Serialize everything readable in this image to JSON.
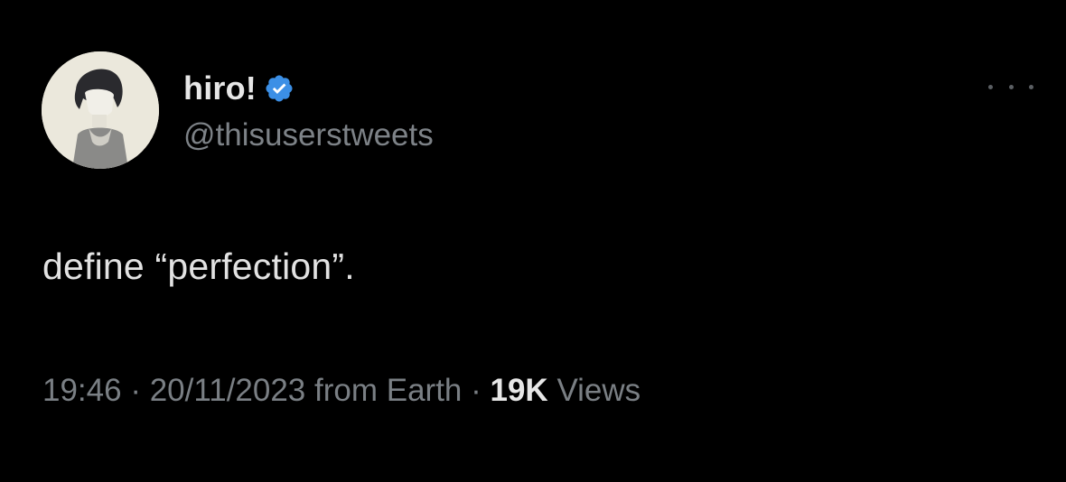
{
  "tweet": {
    "author": {
      "display_name": "hiro!",
      "handle": "@thisuserstweets",
      "verified_icon": "verified-badge-icon",
      "verified_color": "#3b8fe6"
    },
    "text": "define “perfection”.",
    "meta": {
      "time": "19:46",
      "separator1": " · ",
      "date": "20/11/2023",
      "source": " from Earth",
      "separator2": " · ",
      "views_count": "19K",
      "views_label": " Views"
    },
    "more_icon": "more-options-icon"
  }
}
